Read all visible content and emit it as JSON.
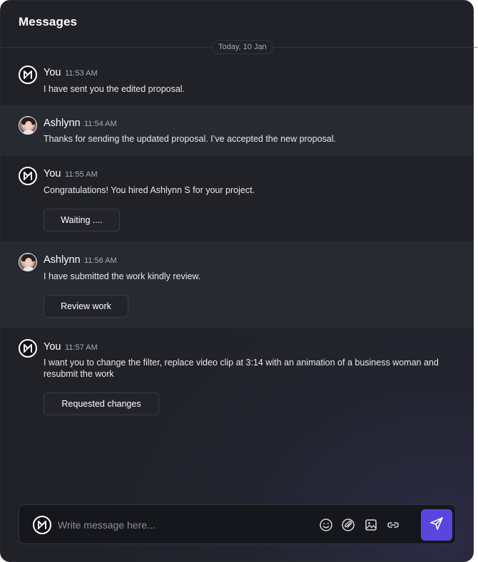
{
  "header": {
    "title": "Messages"
  },
  "date_chip": "Today, 10 Jan",
  "messages": [
    {
      "sender": "You",
      "time": "11:53 AM",
      "text": "I have sent you the edited proposal.",
      "avatar": "brand-logo-icon"
    },
    {
      "sender": "Ashlynn",
      "time": "11:54 AM",
      "text": "Thanks for sending the updated proposal. I’ve accepted the new proposal.",
      "avatar": "user-photo"
    },
    {
      "sender": "You",
      "time": "11:55 AM",
      "text": "Congratulations! You hired Ashlynn S for your project.",
      "avatar": "brand-logo-icon",
      "action": "Waiting ...."
    },
    {
      "sender": "Ashlynn",
      "time": "11:56 AM",
      "text": "I have submitted the work kindly review.",
      "avatar": "user-photo",
      "action": "Review work"
    },
    {
      "sender": "You",
      "time": "11:57 AM",
      "text": "I want you to change the filter, replace video clip at 3:14 with an animation of a business woman and resubmit the work",
      "avatar": "brand-logo-icon",
      "action": "Requested changes"
    }
  ],
  "composer": {
    "placeholder": "Write message here...",
    "tools": [
      "emoji-icon",
      "attachment-icon",
      "image-icon",
      "link-icon"
    ],
    "send_icon": "send-icon"
  },
  "colors": {
    "accent": "#5a46df",
    "background": "#212228",
    "alt_row": "#282a31"
  }
}
